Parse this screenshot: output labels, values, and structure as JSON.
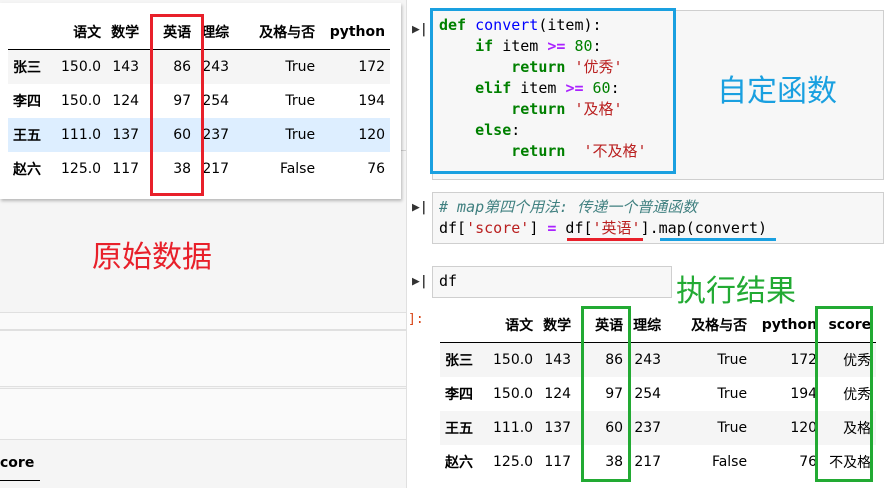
{
  "original_table": {
    "columns": [
      "",
      "语文",
      "数学",
      "英语",
      "理综",
      "及格与否",
      "python"
    ],
    "rows": [
      [
        "张三",
        "150.0",
        "143",
        "86",
        "243",
        "True",
        "172"
      ],
      [
        "李四",
        "150.0",
        "124",
        "97",
        "254",
        "True",
        "194"
      ],
      [
        "王五",
        "111.0",
        "137",
        "60",
        "237",
        "True",
        "120"
      ],
      [
        "赵六",
        "125.0",
        "117",
        "38",
        "217",
        "False",
        "76"
      ]
    ]
  },
  "annotations": {
    "original_data": "原始数据",
    "custom_function": "自定函数",
    "result": "执行结果"
  },
  "code_cell_1": {
    "line1_kw": "def",
    "line1_fn": "convert",
    "line1_rest": "(item):",
    "line2_kw": "if",
    "line2_var": " item ",
    "line2_op": ">=",
    "line2_num": " 80",
    "line2_end": ":",
    "line3_kw": "return",
    "line3_str": " '优秀'",
    "line4_kw": "elif",
    "line4_var": " item ",
    "line4_op": ">=",
    "line4_num": " 60",
    "line4_end": ":",
    "line5_kw": "return",
    "line5_str": " '及格'",
    "line6_kw": "else",
    "line6_end": ":",
    "line7_kw": "return",
    "line7_str": "  '不及格'"
  },
  "code_cell_2": {
    "comment": "# map第四个用法: 传递一个普通函数",
    "a": "df[",
    "b": "'score'",
    "c": "] ",
    "d": "=",
    "e": " df[",
    "f": "'英语'",
    "g": "].map(convert)"
  },
  "code_cell_3": {
    "text": "df"
  },
  "run_icon": "▶|",
  "out_marker": "]:",
  "result_table": {
    "columns": [
      "",
      "语文",
      "数学",
      "英语",
      "理综",
      "及格与否",
      "python",
      "score"
    ],
    "rows": [
      [
        "张三",
        "150.0",
        "143",
        "86",
        "243",
        "True",
        "172",
        "优秀"
      ],
      [
        "李四",
        "150.0",
        "124",
        "97",
        "254",
        "True",
        "194",
        "优秀"
      ],
      [
        "王五",
        "111.0",
        "137",
        "60",
        "237",
        "True",
        "120",
        "及格"
      ],
      [
        "赵六",
        "125.0",
        "117",
        "38",
        "217",
        "False",
        "76",
        "不及格"
      ]
    ]
  },
  "background_fragment": "core",
  "colors": {
    "red": "#e8202a",
    "blue": "#1aa0e0",
    "green": "#22aa33"
  }
}
